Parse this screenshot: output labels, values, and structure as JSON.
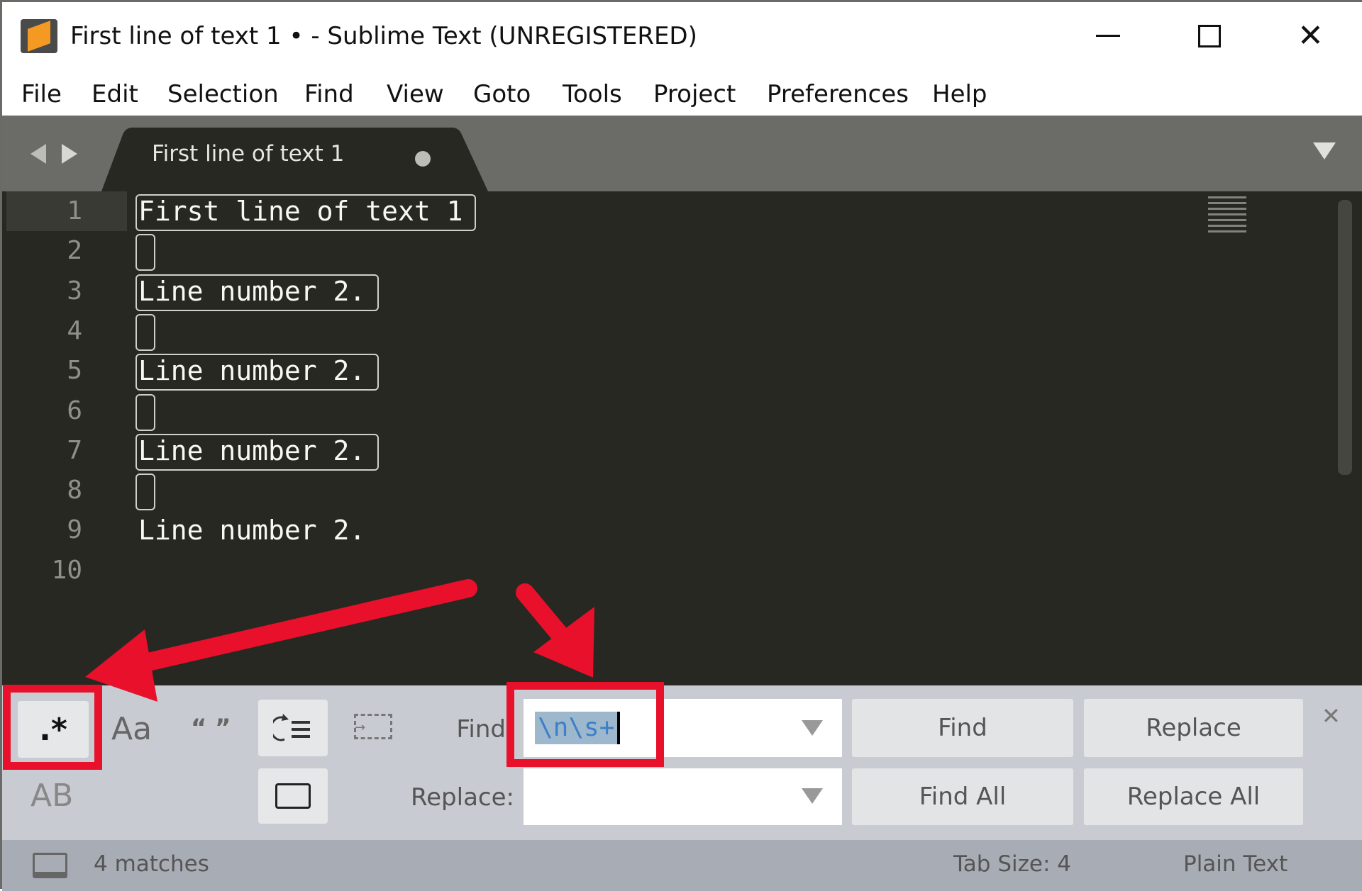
{
  "window": {
    "title": "First line of text 1 • - Sublime Text (UNREGISTERED)",
    "controls": [
      "minimize",
      "maximize",
      "close"
    ]
  },
  "menu": [
    "File",
    "Edit",
    "Selection",
    "Find",
    "View",
    "Goto",
    "Tools",
    "Project",
    "Preferences",
    "Help"
  ],
  "tab": {
    "label": "First line of text 1",
    "dirty": true
  },
  "editor": {
    "line_numbers": [
      "1",
      "2",
      "3",
      "4",
      "5",
      "6",
      "7",
      "8",
      "9",
      "10"
    ],
    "lines": [
      "First line of text 1",
      "",
      "Line number 2.",
      "",
      "Line number 2.",
      "",
      "Line number 2.",
      "",
      "Line number 2.",
      ""
    ]
  },
  "find_panel": {
    "regex_label": ".*",
    "case_label": "Aa",
    "whole_word_label": "“ ”",
    "preserve_case_label": "AB",
    "find_label": "Find",
    "replace_label": "Replace:",
    "find_value": "\\n\\s+",
    "replace_value": "",
    "find_button": "Find",
    "replace_button": "Replace",
    "find_all_button": "Find All",
    "replace_all_button": "Replace All",
    "regex_enabled": true
  },
  "status": {
    "matches": "4 matches",
    "tab_size": "Tab Size: 4",
    "syntax": "Plain Text"
  },
  "colors": {
    "annotation": "#e8102a",
    "editor_bg": "#272822",
    "accent": "#f4a73a"
  }
}
